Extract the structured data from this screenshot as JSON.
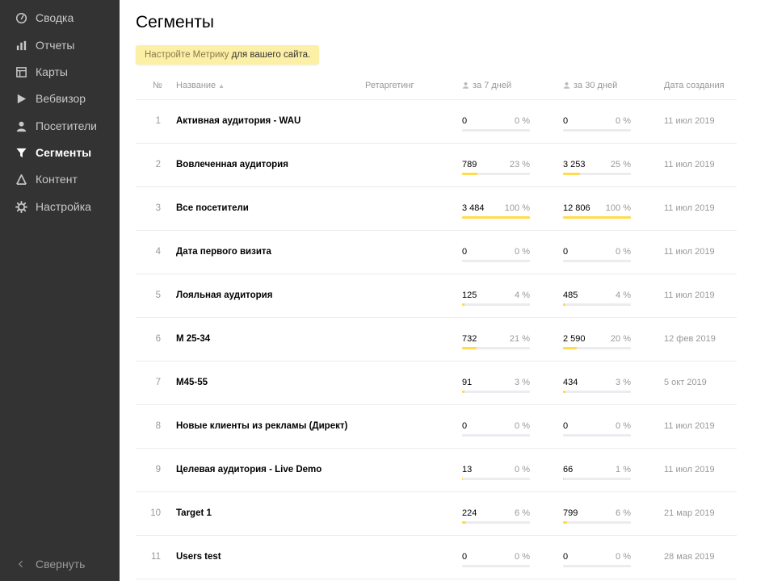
{
  "sidebar": {
    "items": [
      {
        "label": "Сводка",
        "icon": "gauge-icon"
      },
      {
        "label": "Отчеты",
        "icon": "bar-chart-icon"
      },
      {
        "label": "Карты",
        "icon": "map-icon"
      },
      {
        "label": "Вебвизор",
        "icon": "play-icon"
      },
      {
        "label": "Посетители",
        "icon": "user-icon"
      },
      {
        "label": "Сегменты",
        "icon": "filter-icon",
        "active": true
      },
      {
        "label": "Контент",
        "icon": "content-icon"
      },
      {
        "label": "Настройка",
        "icon": "gear-icon"
      }
    ],
    "collapse_label": "Свернуть"
  },
  "page": {
    "title": "Сегменты"
  },
  "banner": {
    "link_text": "Настройте Метрику",
    "rest_text": " для вашего сайта."
  },
  "table": {
    "headers": {
      "num": "№",
      "name": "Название",
      "sort_indicator": "▲",
      "retargeting": "Ретаргетинг",
      "week": "за 7 дней",
      "month": "за 30 дней",
      "created": "Дата создания"
    },
    "rows": [
      {
        "num": "1",
        "name": "Активная аудитория - WAU",
        "v7": "0",
        "p7": "0 %",
        "v30": "0",
        "p30": "0 %",
        "date": "11 июл 2019",
        "f7": 0,
        "f30": 0
      },
      {
        "num": "2",
        "name": "Вовлеченная аудитория",
        "v7": "789",
        "p7": "23 %",
        "v30": "3 253",
        "p30": "25 %",
        "date": "11 июл 2019",
        "f7": 23,
        "f30": 25
      },
      {
        "num": "3",
        "name": "Все посетители",
        "v7": "3 484",
        "p7": "100 %",
        "v30": "12 806",
        "p30": "100 %",
        "date": "11 июл 2019",
        "f7": 100,
        "f30": 100
      },
      {
        "num": "4",
        "name": "Дата первого визита",
        "v7": "0",
        "p7": "0 %",
        "v30": "0",
        "p30": "0 %",
        "date": "11 июл 2019",
        "f7": 0,
        "f30": 0
      },
      {
        "num": "5",
        "name": "Лояльная аудитория",
        "v7": "125",
        "p7": "4 %",
        "v30": "485",
        "p30": "4 %",
        "date": "11 июл 2019",
        "f7": 4,
        "f30": 4
      },
      {
        "num": "6",
        "name": "М 25-34",
        "v7": "732",
        "p7": "21 %",
        "v30": "2 590",
        "p30": "20 %",
        "date": "12 фев 2019",
        "f7": 21,
        "f30": 20
      },
      {
        "num": "7",
        "name": "М45-55",
        "v7": "91",
        "p7": "3 %",
        "v30": "434",
        "p30": "3 %",
        "date": "5 окт 2019",
        "f7": 3,
        "f30": 3
      },
      {
        "num": "8",
        "name": "Новые клиенты из рекламы (Директ)",
        "v7": "0",
        "p7": "0 %",
        "v30": "0",
        "p30": "0 %",
        "date": "11 июл 2019",
        "f7": 0,
        "f30": 0
      },
      {
        "num": "9",
        "name": "Целевая аудитория - Live Demo",
        "v7": "13",
        "p7": "0 %",
        "v30": "66",
        "p30": "1 %",
        "date": "11 июл 2019",
        "f7": 0.4,
        "f30": 0.5
      },
      {
        "num": "10",
        "name": "Target 1",
        "v7": "224",
        "p7": "6 %",
        "v30": "799",
        "p30": "6 %",
        "date": "21 мар 2019",
        "f7": 6,
        "f30": 6
      },
      {
        "num": "11",
        "name": "Users test",
        "v7": "0",
        "p7": "0 %",
        "v30": "0",
        "p30": "0 %",
        "date": "28 мая 2019",
        "f7": 0,
        "f30": 0
      }
    ]
  },
  "colors": {
    "sidebar_bg": "#333333",
    "bar_fill": "#ffdb4d",
    "bar_track": "#ebebf0",
    "banner_bg": "#fcefa6"
  }
}
